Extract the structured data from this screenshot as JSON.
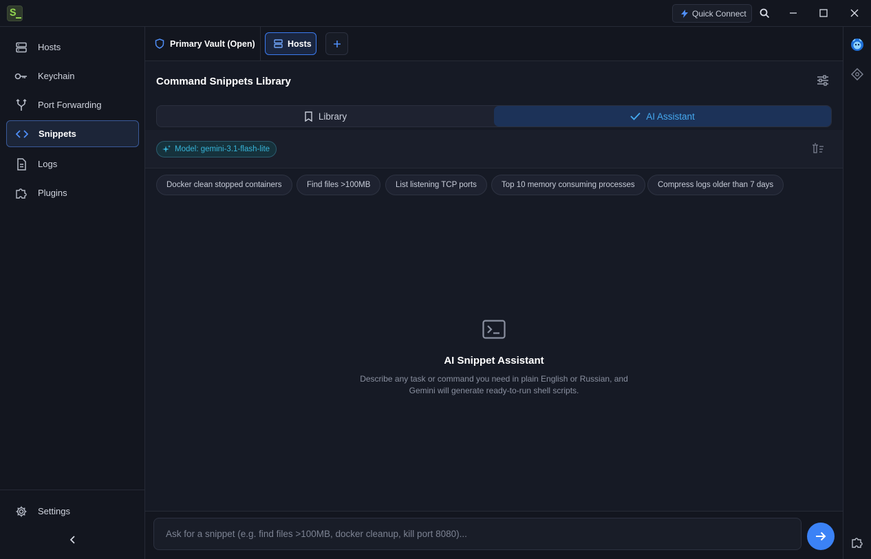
{
  "app": {
    "logo_letter": "S"
  },
  "titlebar": {
    "quick_connect_label": "Quick Connect",
    "icons": [
      "bolt-icon",
      "search-icon",
      "minimize-icon",
      "maximize-icon",
      "close-icon"
    ]
  },
  "sidebar": {
    "items": [
      {
        "label": "Hosts",
        "icon": "server-icon",
        "active": false
      },
      {
        "label": "Keychain",
        "icon": "key-icon",
        "active": false
      },
      {
        "label": "Port Forwarding",
        "icon": "fork-icon",
        "active": false
      },
      {
        "label": "Snippets",
        "icon": "code-icon",
        "active": true
      },
      {
        "label": "Logs",
        "icon": "file-icon",
        "active": false
      },
      {
        "label": "Plugins",
        "icon": "puzzle-icon",
        "active": false
      }
    ],
    "settings_label": "Settings",
    "collapse_icon": "chevron-left-icon"
  },
  "tabs": {
    "vault_label": "Primary Vault (Open)",
    "hosts_label": "Hosts",
    "add_icon": "plus-icon"
  },
  "page": {
    "title": "Command Snippets Library",
    "segments": {
      "library": "Library",
      "ai": "AI Assistant",
      "selected": "AI Assistant"
    },
    "model_badge": "Model: gemini-3.1-flash-lite",
    "suggestions": [
      "Docker clean stopped containers",
      "Find files >100MB",
      "List listening TCP ports",
      "Top 10 memory consuming processes",
      "Compress logs older than 7 days"
    ],
    "empty": {
      "title": "AI Snippet Assistant",
      "description": "Describe any task or command you need in plain English or Russian, and Gemini will generate ready-to-run shell scripts."
    }
  },
  "prompt": {
    "value": "",
    "placeholder": "Ask for a snippet (e.g. find files >100MB, docker cleanup, kill port 8080)..."
  },
  "colors": {
    "accent": "#3b82f6",
    "ai_accent": "#45a8ef",
    "model_badge": "#37b4d8",
    "background": "#161a25"
  }
}
